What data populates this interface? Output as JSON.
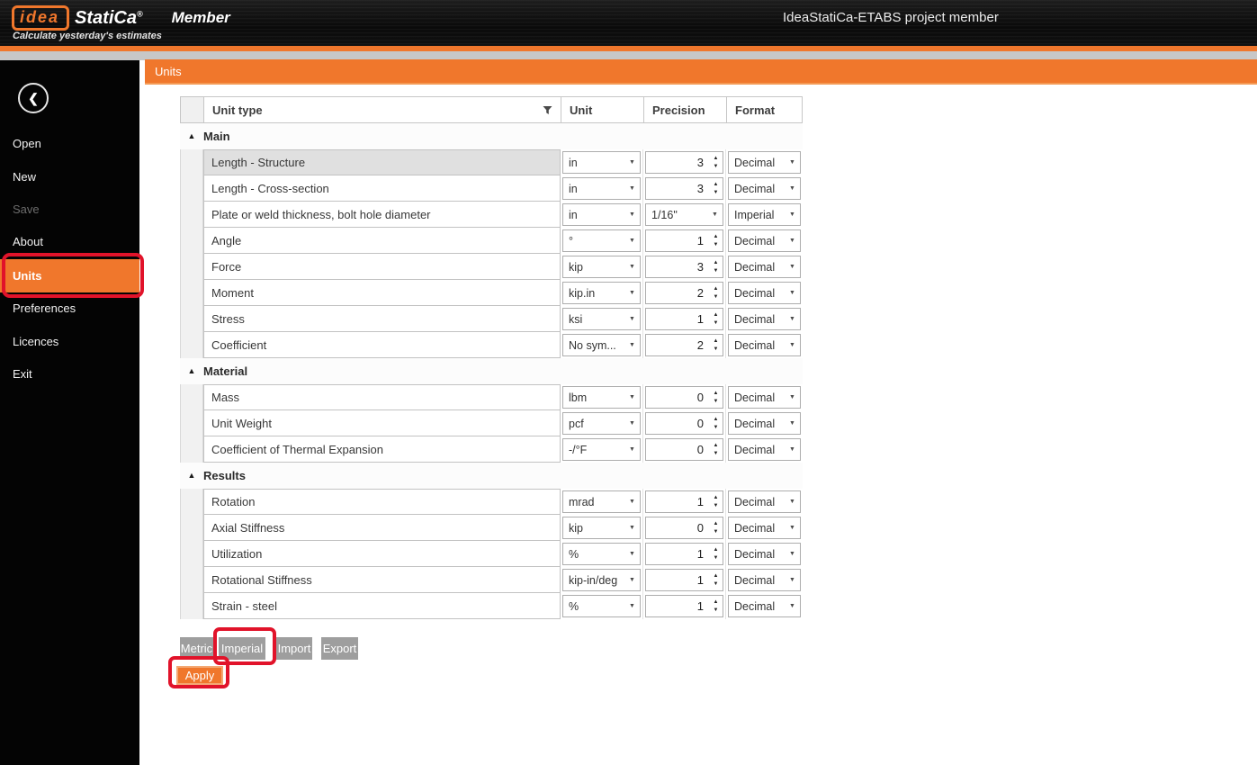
{
  "header": {
    "logo_idea": "idea",
    "logo_statica": "StatiCa",
    "logo_reg": "®",
    "logo_member": "Member",
    "tagline": "Calculate yesterday's estimates",
    "window_title": "IdeaStatiCa-ETABS project member"
  },
  "sidebar": {
    "items": [
      {
        "label": "Open",
        "state": "normal"
      },
      {
        "label": "New",
        "state": "normal"
      },
      {
        "label": "Save",
        "state": "disabled"
      },
      {
        "label": "About",
        "state": "normal"
      },
      {
        "label": "Units",
        "state": "active"
      },
      {
        "label": "Preferences",
        "state": "normal"
      },
      {
        "label": "Licences",
        "state": "normal"
      },
      {
        "label": "Exit",
        "state": "normal"
      }
    ]
  },
  "panel": {
    "title": "Units"
  },
  "table": {
    "headers": {
      "unit_type": "Unit type",
      "unit": "Unit",
      "precision": "Precision",
      "format": "Format"
    },
    "groups": [
      {
        "label": "Main",
        "rows": [
          {
            "name": "Length - Structure",
            "unit": "in",
            "precision": "3",
            "precision_type": "spinner",
            "format": "Decimal",
            "selected": true
          },
          {
            "name": "Length - Cross-section",
            "unit": "in",
            "precision": "3",
            "precision_type": "spinner",
            "format": "Decimal"
          },
          {
            "name": "Plate or weld thickness, bolt hole diameter",
            "unit": "in",
            "precision": "1/16\"",
            "precision_type": "dropdown",
            "format": "Imperial"
          },
          {
            "name": "Angle",
            "unit": "°",
            "precision": "1",
            "precision_type": "spinner",
            "format": "Decimal"
          },
          {
            "name": "Force",
            "unit": "kip",
            "precision": "3",
            "precision_type": "spinner",
            "format": "Decimal"
          },
          {
            "name": "Moment",
            "unit": "kip.in",
            "precision": "2",
            "precision_type": "spinner",
            "format": "Decimal"
          },
          {
            "name": "Stress",
            "unit": "ksi",
            "precision": "1",
            "precision_type": "spinner",
            "format": "Decimal"
          },
          {
            "name": "Coefficient",
            "unit": "No sym...",
            "precision": "2",
            "precision_type": "spinner",
            "format": "Decimal"
          }
        ]
      },
      {
        "label": "Material",
        "rows": [
          {
            "name": "Mass",
            "unit": "lbm",
            "precision": "0",
            "precision_type": "spinner",
            "format": "Decimal"
          },
          {
            "name": "Unit Weight",
            "unit": "pcf",
            "precision": "0",
            "precision_type": "spinner",
            "format": "Decimal"
          },
          {
            "name": "Coefficient of Thermal Expansion",
            "unit": "-/°F",
            "precision": "0",
            "precision_type": "spinner",
            "format": "Decimal"
          }
        ]
      },
      {
        "label": "Results",
        "rows": [
          {
            "name": "Rotation",
            "unit": "mrad",
            "precision": "1",
            "precision_type": "spinner",
            "format": "Decimal"
          },
          {
            "name": "Axial Stiffness",
            "unit": "kip",
            "precision": "0",
            "precision_type": "spinner",
            "format": "Decimal"
          },
          {
            "name": "Utilization",
            "unit": "%",
            "precision": "1",
            "precision_type": "spinner",
            "format": "Decimal"
          },
          {
            "name": "Rotational Stiffness",
            "unit": "kip-in/deg",
            "precision": "1",
            "precision_type": "spinner",
            "format": "Decimal"
          },
          {
            "name": "Strain - steel",
            "unit": "%",
            "precision": "1",
            "precision_type": "spinner",
            "format": "Decimal"
          }
        ]
      }
    ]
  },
  "buttons": {
    "metric": "Metric",
    "imperial": "Imperial",
    "import": "Import",
    "export": "Export",
    "apply": "Apply"
  },
  "icons": {
    "back": "❮",
    "collapse": "▲",
    "dropdown": "▼",
    "spin_up": "▲",
    "spin_down": "▼"
  },
  "colors": {
    "accent_orange": "#F0772C",
    "annotation_red": "#E1132A",
    "button_grey": "#9E9E9E"
  }
}
